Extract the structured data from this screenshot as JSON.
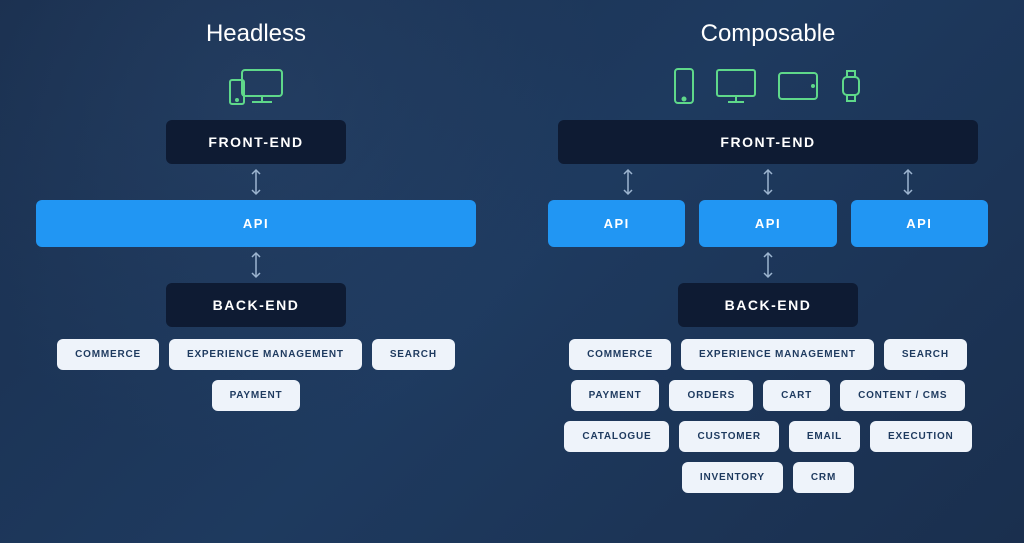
{
  "headless": {
    "title": "Headless",
    "frontend": "FRONT-END",
    "api": "API",
    "backend": "BACK-END",
    "services": [
      "COMMERCE",
      "EXPERIENCE MANAGEMENT",
      "SEARCH",
      "PAYMENT"
    ]
  },
  "composable": {
    "title": "Composable",
    "frontend": "FRONT-END",
    "api": [
      "API",
      "API",
      "API"
    ],
    "backend": "BACK-END",
    "services": [
      "COMMERCE",
      "EXPERIENCE MANAGEMENT",
      "SEARCH",
      "PAYMENT",
      "ORDERS",
      "CART",
      "CONTENT / CMS",
      "CATALOGUE",
      "CUSTOMER",
      "EMAIL",
      "EXECUTION",
      "INVENTORY",
      "CRM"
    ]
  }
}
